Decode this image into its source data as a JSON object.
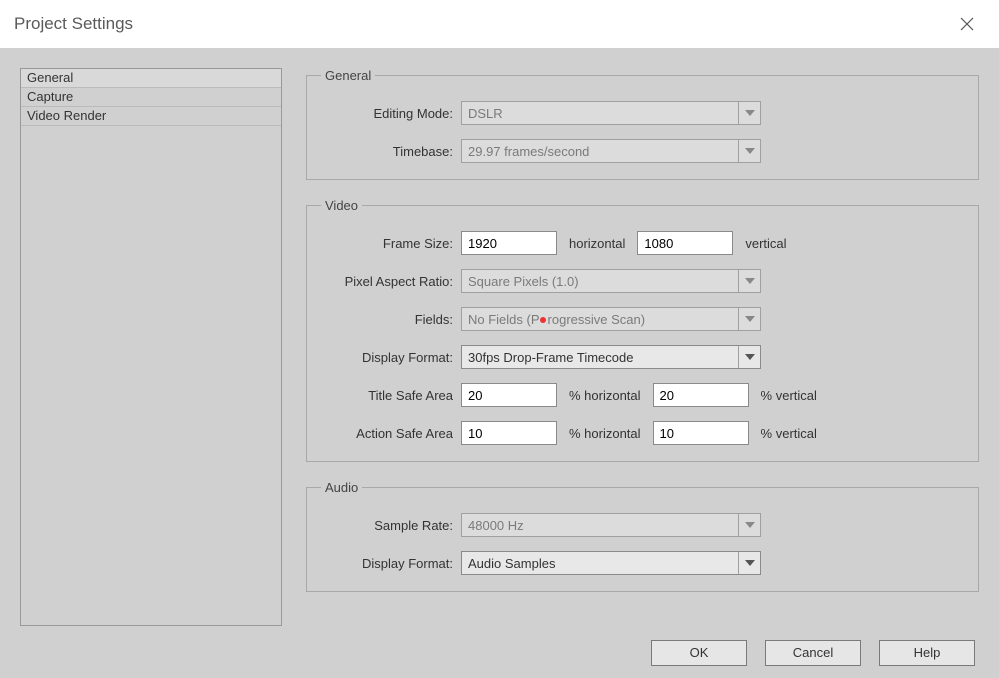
{
  "window": {
    "title": "Project Settings"
  },
  "sidebar": {
    "items": [
      {
        "label": "General",
        "selected": true
      },
      {
        "label": "Capture",
        "selected": false
      },
      {
        "label": "Video Render",
        "selected": false
      }
    ]
  },
  "groups": {
    "general": {
      "legend": "General",
      "editing_mode": {
        "label": "Editing Mode:",
        "value": "DSLR",
        "disabled": true
      },
      "timebase": {
        "label": "Timebase:",
        "value": "29.97 frames/second",
        "disabled": true
      }
    },
    "video": {
      "legend": "Video",
      "frame_size": {
        "label": "Frame Size:",
        "width": "1920",
        "between": "horizontal",
        "height": "1080",
        "after": "vertical"
      },
      "pixel_aspect": {
        "label": "Pixel Aspect Ratio:",
        "value": "Square Pixels (1.0)",
        "disabled": true
      },
      "fields": {
        "label": "Fields:",
        "prefix": "No Fields (P",
        "suffix": "rogressive Scan)",
        "disabled": true
      },
      "display_fmt": {
        "label": "Display Format:",
        "value": "30fps Drop-Frame Timecode",
        "disabled": false
      },
      "title_safe": {
        "label": "Title Safe Area",
        "h": "20",
        "h_unit": "% horizontal",
        "v": "20",
        "v_unit": "% vertical"
      },
      "action_safe": {
        "label": "Action Safe Area",
        "h": "10",
        "h_unit": "% horizontal",
        "v": "10",
        "v_unit": "% vertical"
      }
    },
    "audio": {
      "legend": "Audio",
      "sample_rate": {
        "label": "Sample Rate:",
        "value": "48000 Hz",
        "disabled": true
      },
      "display_fmt": {
        "label": "Display Format:",
        "value": "Audio Samples",
        "disabled": false
      }
    }
  },
  "buttons": {
    "ok": "OK",
    "cancel": "Cancel",
    "help": "Help"
  }
}
